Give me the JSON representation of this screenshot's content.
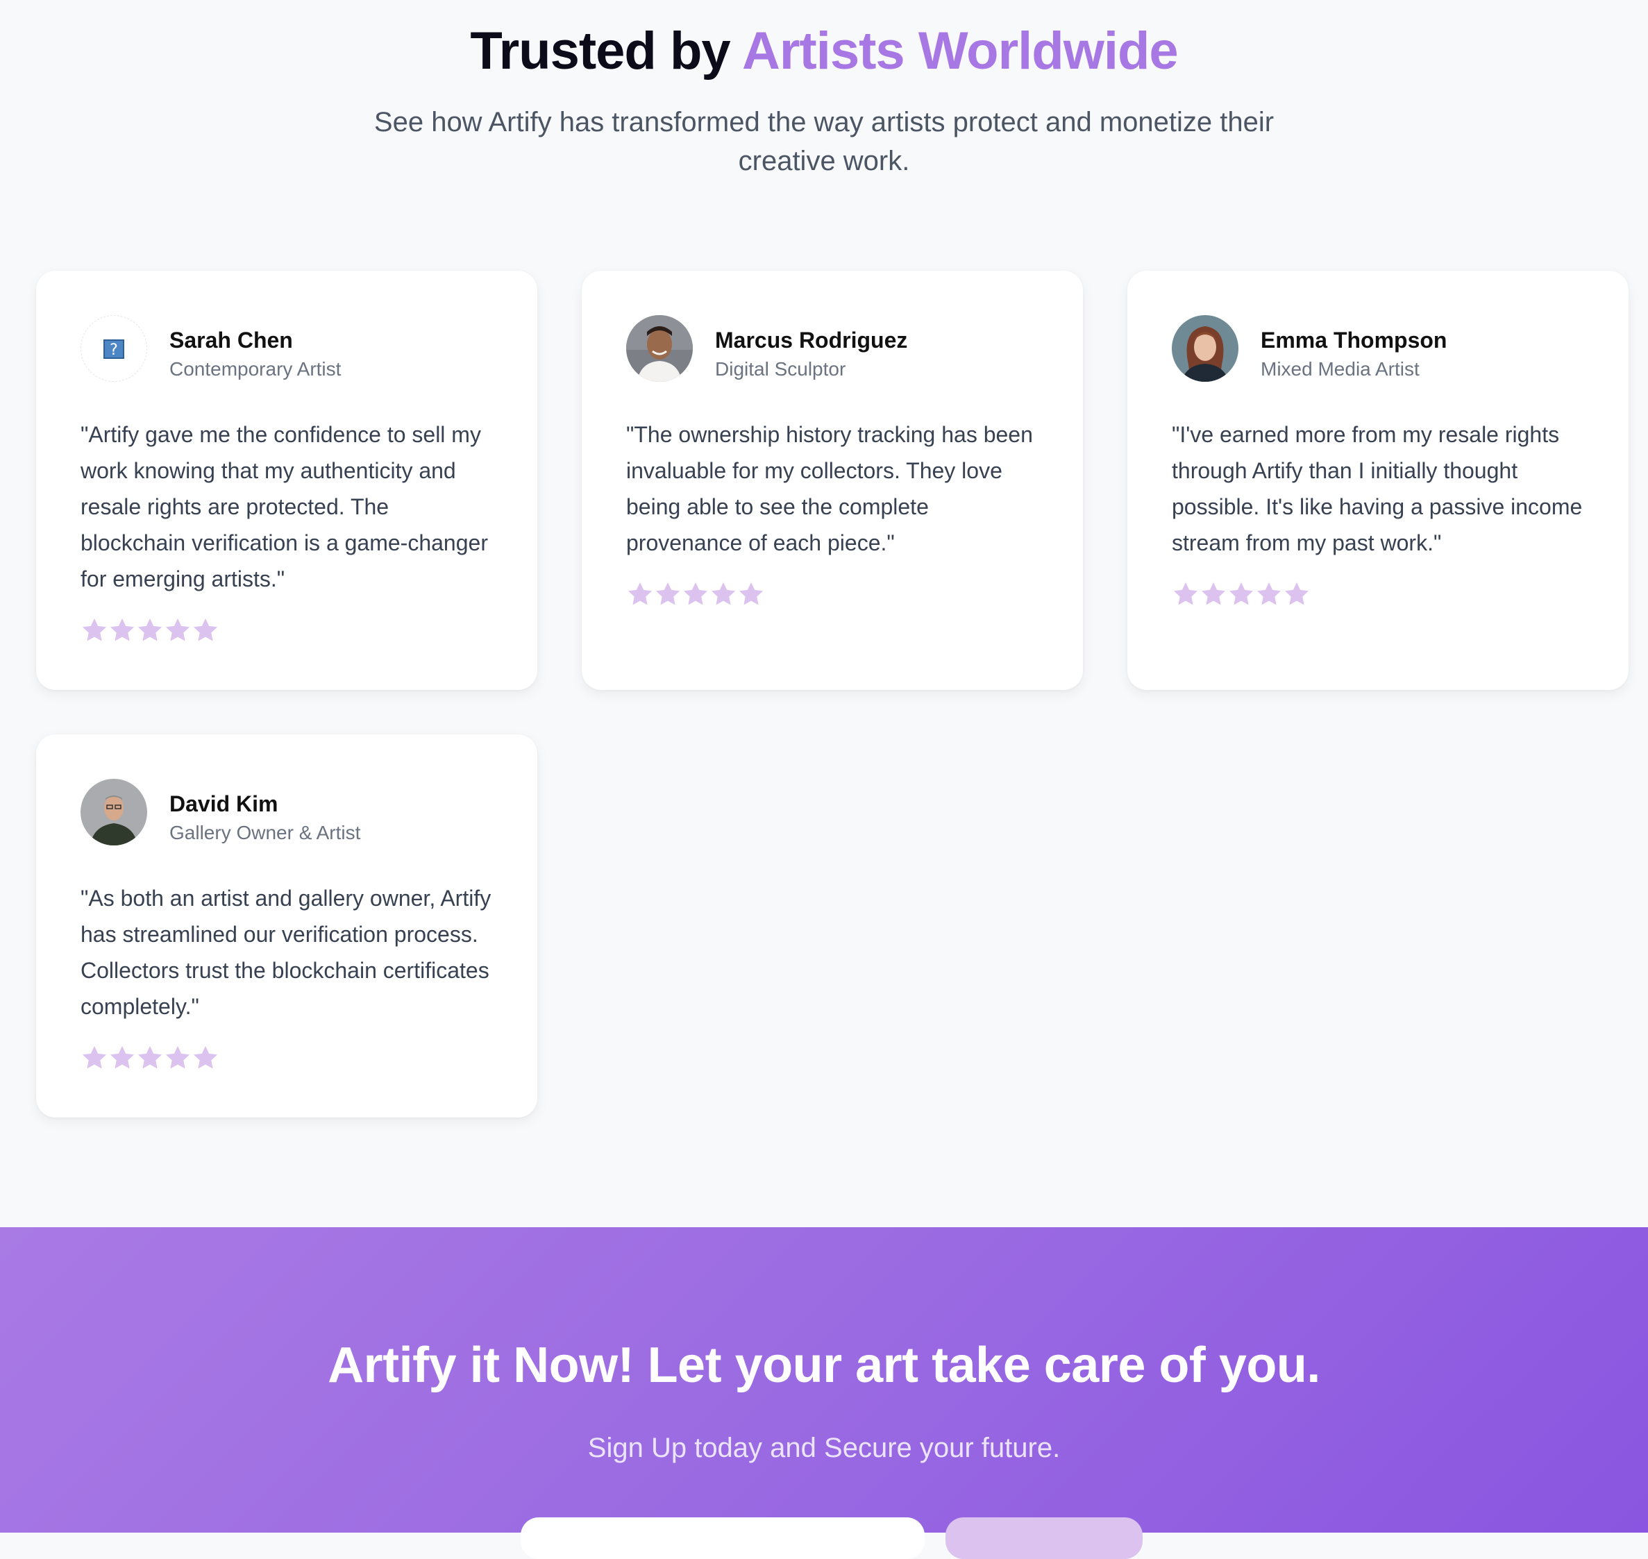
{
  "header": {
    "title_part1": "Trusted by ",
    "title_accent": "Artists Worldwide",
    "subtitle": "See how Artify has transformed the way artists protect and monetize their creative work."
  },
  "colors": {
    "accent": "#a777e3",
    "star": "#dcc2ee",
    "cta_gradient_start": "#a97ae4",
    "cta_gradient_end": "#8a55e0"
  },
  "testimonials": [
    {
      "name": "Sarah Chen",
      "role": "Contemporary Artist",
      "quote": "\"Artify gave me the confidence to sell my work knowing that my authenticity and resale rights are protected. The blockchain verification is a game-changer for emerging artists.\"",
      "rating": 5,
      "avatar": "broken-image-icon"
    },
    {
      "name": "Marcus Rodriguez",
      "role": "Digital Sculptor",
      "quote": "\"The ownership history tracking has been invaluable for my collectors. They love being able to see the complete provenance of each piece.\"",
      "rating": 5,
      "avatar": "avatar-photo"
    },
    {
      "name": "Emma Thompson",
      "role": "Mixed Media Artist",
      "quote": "\"I've earned more from my resale rights through Artify than I initially thought possible. It's like having a passive income stream from my past work.\"",
      "rating": 5,
      "avatar": "avatar-photo"
    },
    {
      "name": "David Kim",
      "role": "Gallery Owner & Artist",
      "quote": "\"As both an artist and gallery owner, Artify has streamlined our verification process. Collectors trust the blockchain certificates completely.\"",
      "rating": 5,
      "avatar": "avatar-photo"
    }
  ],
  "cta": {
    "title": "Artify it Now! Let your art take care of you.",
    "subtitle": "Sign Up today and Secure your future.",
    "input_placeholder": "",
    "button_label": ""
  }
}
